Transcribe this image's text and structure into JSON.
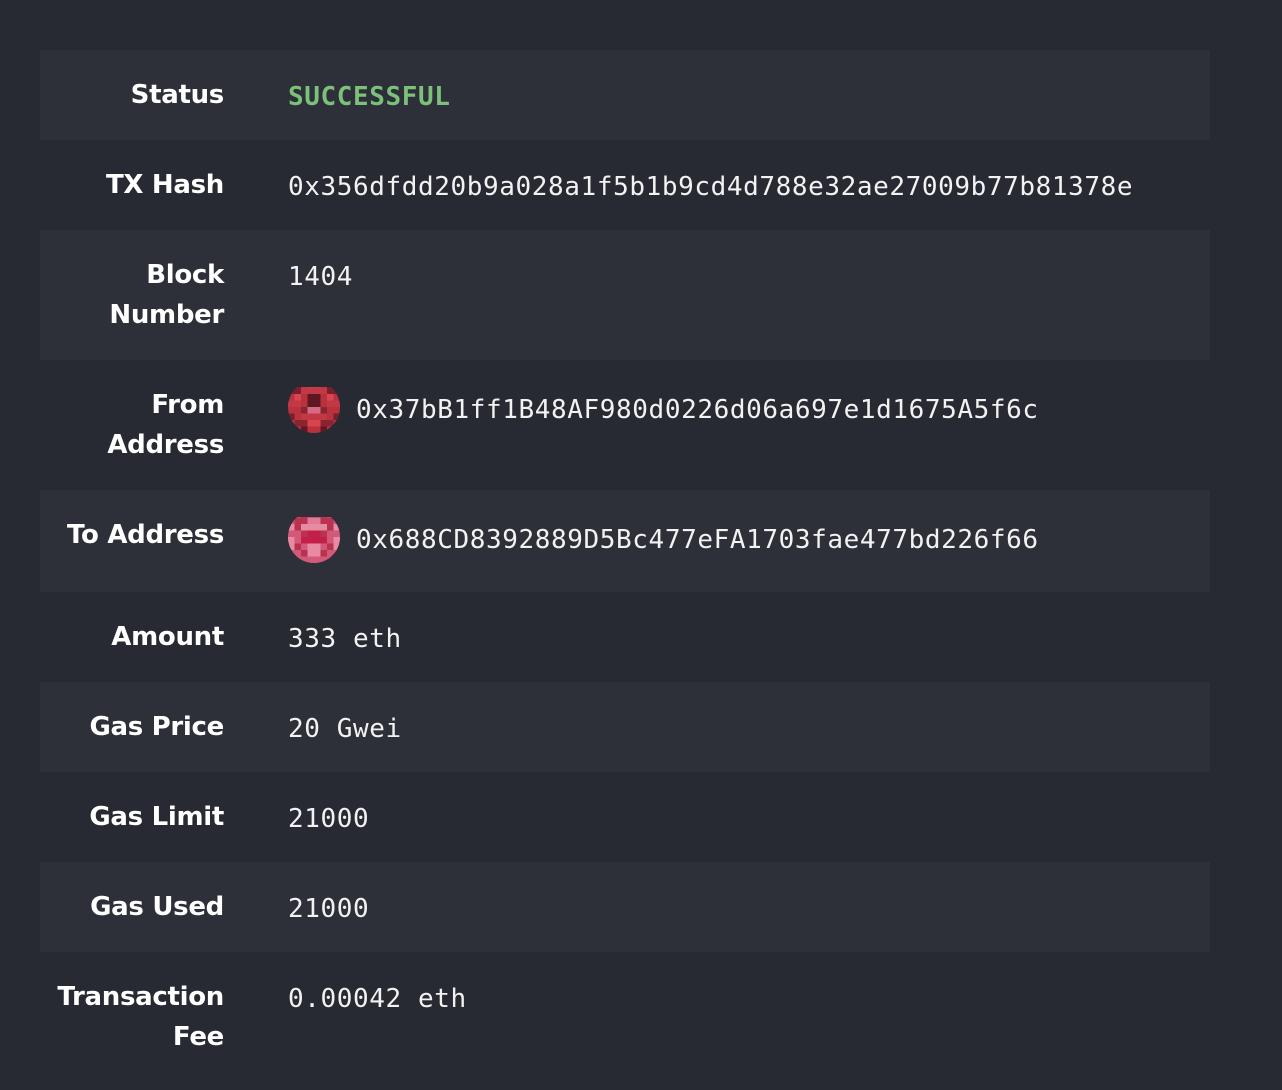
{
  "rows": [
    {
      "label": "Status",
      "value": "SUCCESSFUL"
    },
    {
      "label": "TX Hash",
      "value": "0x356dfdd20b9a028a1f5b1b9cd4d788e32ae27009b77b81378e"
    },
    {
      "label": "Block Number",
      "value": "1404"
    },
    {
      "label": "From Address",
      "value": "0x37bB1ff1B48AF980d0226d06a697e1d1675A5f6c"
    },
    {
      "label": "To Address",
      "value": "0x688CD8392889D5Bc477eFA1703fae477bd226f66"
    },
    {
      "label": "Amount",
      "value": "333 eth"
    },
    {
      "label": "Gas Price",
      "value": "20 Gwei"
    },
    {
      "label": "Gas Limit",
      "value": "21000"
    },
    {
      "label": "Gas Used",
      "value": "21000"
    },
    {
      "label": "Transaction Fee",
      "value": "0.00042 eth"
    }
  ],
  "colors": {
    "background": "#272a32",
    "row_shade": "#2d3039",
    "success": "#7cc07a",
    "label": "#ffffff",
    "value": "#f2f2f2"
  },
  "icons": {
    "from_avatar": "blockie-avatar",
    "to_avatar": "blockie-avatar"
  }
}
